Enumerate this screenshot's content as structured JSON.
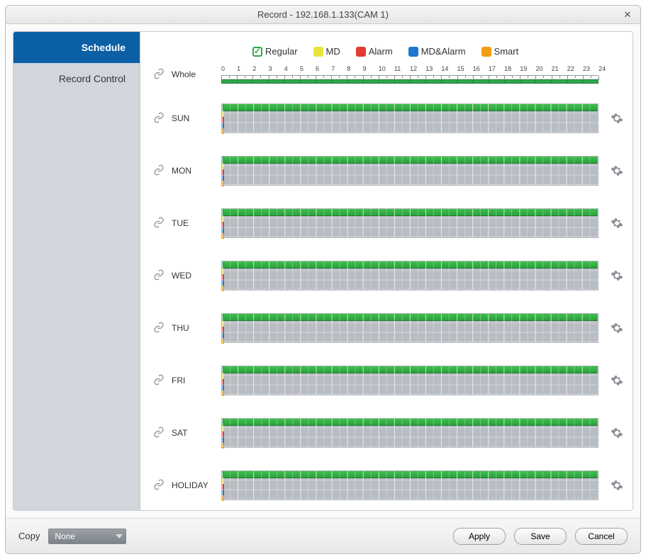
{
  "title": "Record - 192.168.1.133(CAM 1)",
  "sidebar": {
    "items": [
      {
        "label": "Schedule",
        "active": true
      },
      {
        "label": "Record Control",
        "active": false
      }
    ]
  },
  "legend": {
    "regular": "Regular",
    "md": "MD",
    "alarm": "Alarm",
    "md_alarm": "MD&Alarm",
    "smart": "Smart"
  },
  "schedule": {
    "whole_label": "Whole",
    "hours": [
      "0",
      "1",
      "2",
      "3",
      "4",
      "5",
      "6",
      "7",
      "8",
      "9",
      "10",
      "11",
      "12",
      "13",
      "14",
      "15",
      "16",
      "17",
      "18",
      "19",
      "20",
      "21",
      "22",
      "23",
      "24"
    ],
    "days": [
      {
        "label": "SUN"
      },
      {
        "label": "MON"
      },
      {
        "label": "TUE"
      },
      {
        "label": "WED"
      },
      {
        "label": "THU"
      },
      {
        "label": "FRI"
      },
      {
        "label": "SAT"
      },
      {
        "label": "HOLIDAY"
      }
    ]
  },
  "bottom": {
    "copy_label": "Copy",
    "copy_value": "None",
    "apply": "Apply",
    "save": "Save",
    "cancel": "Cancel"
  },
  "colors": {
    "regular": "#2fa84a",
    "md": "#e9e43a",
    "alarm": "#e23b32",
    "md_alarm": "#1f77d0",
    "smart": "#f39c12",
    "sidebar_active": "#0b5fa5"
  }
}
